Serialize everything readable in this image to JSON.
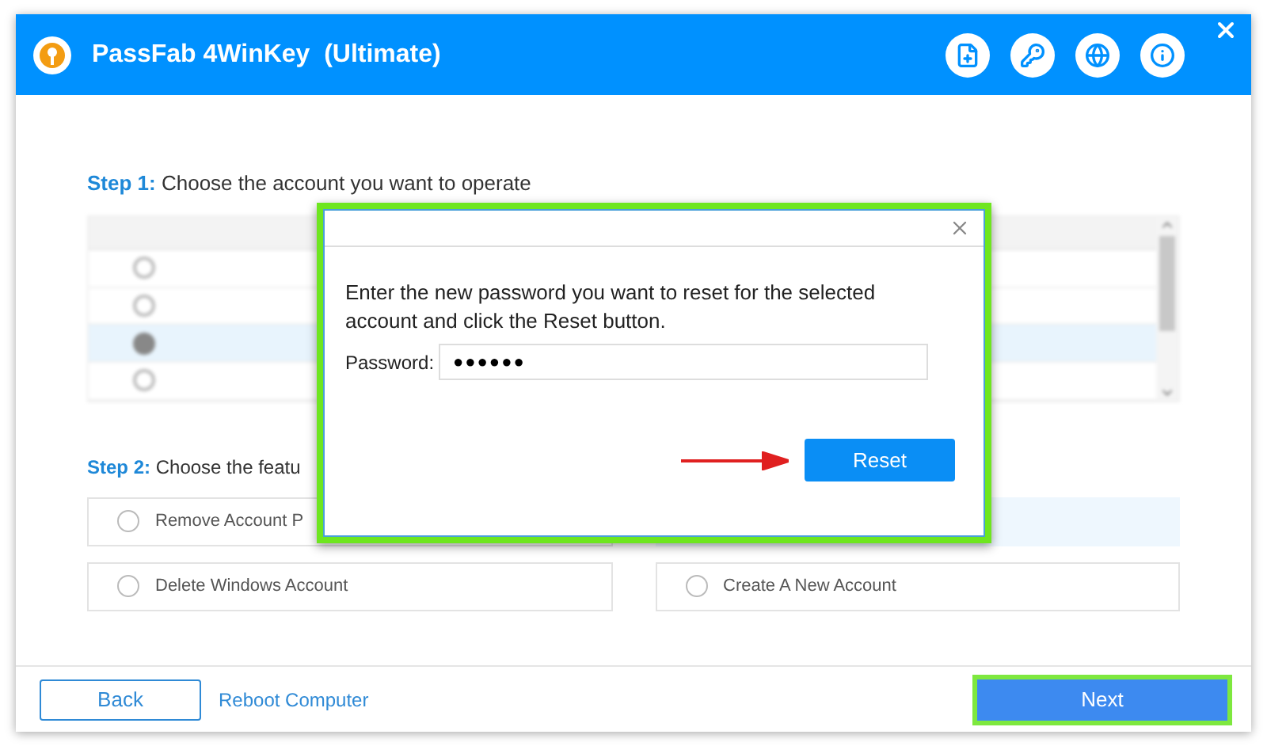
{
  "window": {
    "title": "PassFab 4WinKey  (Ultimate)"
  },
  "step1": {
    "label": "Step 1:",
    "text": "Choose the account you want to operate"
  },
  "accounts": [
    {
      "selected": false
    },
    {
      "selected": false
    },
    {
      "selected": true
    },
    {
      "selected": false
    }
  ],
  "step2": {
    "label": "Step 2:",
    "text": "Choose the featu"
  },
  "features": [
    {
      "label": "Remove Account P",
      "selected": false
    },
    {
      "selected": true
    },
    {
      "label": "Delete Windows Account",
      "selected": false
    },
    {
      "label": "Create A New Account",
      "selected": false
    }
  ],
  "dialog": {
    "highlighted": true,
    "message": "Enter the new password you want to reset for the selected account and click the Reset button.",
    "password_label": "Password:",
    "password_value": "●●●●●●",
    "button": "Reset"
  },
  "footer": {
    "back": "Back",
    "reboot": "Reboot Computer",
    "next": {
      "label": "Next",
      "highlighted": true
    }
  }
}
